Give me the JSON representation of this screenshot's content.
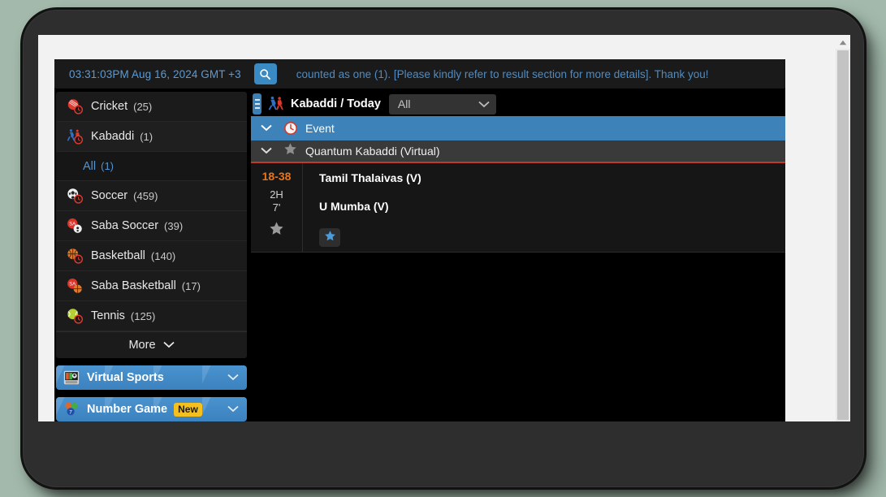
{
  "topbar": {
    "clock": "03:31:03PM Aug 16, 2024 GMT +3",
    "search_icon": "search-icon",
    "ticker": "counted as one (1). [Please kindly refer to result section for more details]. Thank you!"
  },
  "sidebar": {
    "sports": [
      {
        "icon": "cricket-ball-icon",
        "label": "Cricket",
        "count": "(25)"
      },
      {
        "icon": "kabaddi-icon",
        "label": "Kabaddi",
        "count": "(1)"
      },
      {
        "icon": "soccer-ball-icon",
        "label": "Soccer",
        "count": "(459)"
      },
      {
        "icon": "saba-soccer-icon",
        "label": "Saba Soccer",
        "count": "(39)"
      },
      {
        "icon": "basketball-icon",
        "label": "Basketball",
        "count": "(140)"
      },
      {
        "icon": "saba-basketball-icon",
        "label": "Saba Basketball",
        "count": "(17)"
      },
      {
        "icon": "tennis-ball-icon",
        "label": "Tennis",
        "count": "(125)"
      }
    ],
    "sub_item": {
      "label": "All",
      "count": "(1)"
    },
    "more_label": "More",
    "promos": [
      {
        "icon": "virtual-sports-icon",
        "label": "Virtual Sports",
        "badge": ""
      },
      {
        "icon": "number-game-icon",
        "label": "Number Game",
        "badge": "New"
      }
    ]
  },
  "main": {
    "header": {
      "grip_icon": "drag-grip-icon",
      "sport_icon": "kabaddi-icon",
      "title": "Kabaddi / Today",
      "filter_value": "All"
    },
    "event_bar": {
      "icon": "clock-icon",
      "label": "Event"
    },
    "league_bar": {
      "icon": "star-icon",
      "label": "Quantum Kabaddi (Virtual)"
    },
    "match": {
      "score": "18-38",
      "period": "2H",
      "minute": "7'",
      "favorite_icon": "star-icon",
      "home_team": "Tamil Thalaivas (V)",
      "away_team": "U Mumba (V)",
      "fav_button_icon": "star-icon"
    }
  },
  "colors": {
    "accent_blue": "#3d82b8",
    "score_orange": "#e8751a",
    "league_underline_red": "#c03a25",
    "badge_yellow": "#f3c020",
    "link_blue": "#4d95d6"
  }
}
